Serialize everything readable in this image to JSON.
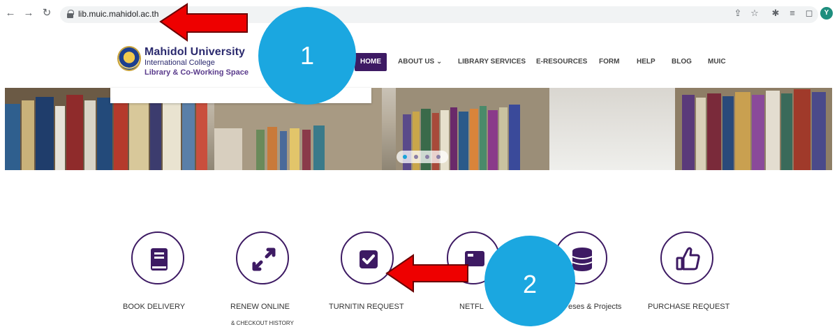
{
  "browser": {
    "url_host": "lib.muic.mahidol.ac.th",
    "profile_initial": "Y",
    "nav_icons": [
      "back-icon",
      "forward-icon",
      "reload-icon",
      "lock-icon"
    ],
    "toolbar_icons": [
      "share-icon",
      "star-icon",
      "extensions-icon",
      "reading-list-icon",
      "side-panel-icon"
    ]
  },
  "header": {
    "logo_title": "Mahidol University",
    "logo_sub": "International College",
    "logo_sub2": "Library & Co-Working Space",
    "menu": [
      {
        "label": "HOME",
        "active": true
      },
      {
        "label": "ABOUT US ⌄"
      },
      {
        "label": "LIBRARY SERVICES"
      },
      {
        "label": "E-RESOURCES"
      },
      {
        "label": "FORM"
      },
      {
        "label": "HELP"
      },
      {
        "label": "BLOG"
      },
      {
        "label": "MUIC"
      }
    ]
  },
  "hero": {
    "slides": 4,
    "active_slide": 1
  },
  "quick_links": [
    {
      "label": "BOOK DELIVERY",
      "icon": "book-icon"
    },
    {
      "label": "RENEW ONLINE",
      "sublabel": "& CHECKOUT HISTORY",
      "icon": "expand-arrows-icon"
    },
    {
      "label": "TURNITIN REQUEST",
      "icon": "checkbox-icon"
    },
    {
      "label": "NETFL",
      "icon": "media-icon"
    },
    {
      "label": "eses & Projects",
      "icon": "database-icon"
    },
    {
      "label": "PURCHASE REQUEST",
      "icon": "thumbs-up-icon"
    }
  ],
  "annotations": [
    {
      "number": "1"
    },
    {
      "number": "2"
    }
  ],
  "colors": {
    "brand_purple": "#3d1a63",
    "callout_blue": "#1ba7e0",
    "arrow_red": "#ee0000"
  }
}
